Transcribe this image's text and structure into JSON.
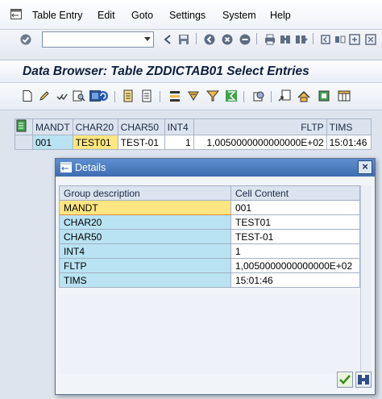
{
  "menu": {
    "items": [
      "Table Entry",
      "Edit",
      "Goto",
      "Settings",
      "System",
      "Help"
    ]
  },
  "system_toolbar": {
    "command_field_value": "",
    "icons": [
      "enter-icon",
      "back-icon",
      "save-icon",
      "back-green-icon",
      "exit-icon",
      "cancel-icon",
      "print-icon",
      "find-icon",
      "find-next-icon",
      "first-page-icon",
      "prev-page-icon",
      "next-page-icon",
      "last-page-icon",
      "new-session-icon",
      "shortcut-icon",
      "help-icon",
      "layout-icon"
    ]
  },
  "page_title": "Data Browser: Table ZDDICTAB01 Select Entries",
  "app_toolbar": {
    "icons": [
      "display-icon",
      "change-icon",
      "check-table-icon",
      "where-used-icon",
      "refresh-icon",
      "detail-icon",
      "detail-list-icon",
      "sort-ascending-icon",
      "sort-descending-icon",
      "filter-icon",
      "total-icon",
      "print-preview-icon",
      "export-icon",
      "upload-icon",
      "download-icon",
      "layout-icon"
    ]
  },
  "table": {
    "columns": [
      "MANDT",
      "CHAR20",
      "CHAR50",
      "INT4",
      "FLTP",
      "TIMS"
    ],
    "rows": [
      [
        "001",
        "TEST01",
        "TEST-01",
        "1",
        "1,0050000000000000E+02",
        "15:01:46"
      ]
    ]
  },
  "dialog": {
    "title": "Details",
    "col_group": "Group description",
    "col_content": "Cell Content",
    "rows": [
      {
        "field": "MANDT",
        "value": "001"
      },
      {
        "field": "CHAR20",
        "value": "TEST01"
      },
      {
        "field": "CHAR50",
        "value": "TEST-01"
      },
      {
        "field": "INT4",
        "value": "1"
      },
      {
        "field": "FLTP",
        "value": "1,0050000000000000E+02"
      },
      {
        "field": "TIMS",
        "value": "15:01:46"
      }
    ]
  },
  "colors": {
    "selected_cell": "#ffe680",
    "key_cell": "#b9e3f2",
    "dialog_title_bar": "#4a7cc0",
    "page_title_text": "#0e1f3e"
  }
}
